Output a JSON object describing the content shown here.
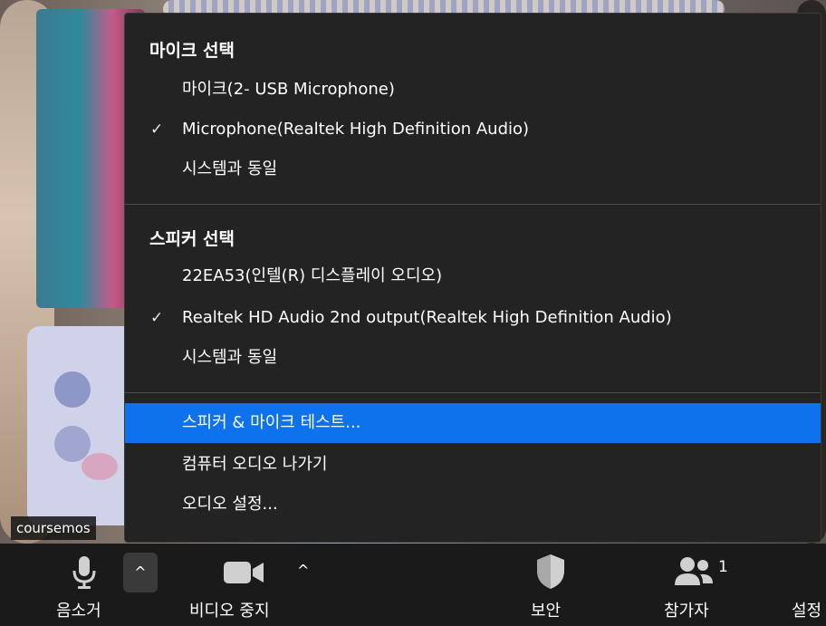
{
  "video": {
    "participant_name": "coursemos"
  },
  "menu": {
    "mic_section": {
      "title": "마이크 선택",
      "items": [
        {
          "label": "마이크(2- USB Microphone)",
          "checked": false
        },
        {
          "label": "Microphone(Realtek High Definition Audio)",
          "checked": true
        },
        {
          "label": "시스템과 동일",
          "checked": false
        }
      ]
    },
    "speaker_section": {
      "title": "스피커 선택",
      "items": [
        {
          "label": "22EA53(인텔(R) 디스플레이 오디오)",
          "checked": false
        },
        {
          "label": "Realtek HD Audio 2nd output(Realtek High Definition Audio)",
          "checked": true
        },
        {
          "label": "시스템과 동일",
          "checked": false
        }
      ]
    },
    "actions": [
      {
        "label": "스피커 & 마이크 테스트...",
        "highlighted": true
      },
      {
        "label": "컴퓨터 오디오 나가기",
        "highlighted": false
      },
      {
        "label": "오디오 설정...",
        "highlighted": false
      }
    ],
    "check_glyph": "✓",
    "highlight_color": "#0e72ed"
  },
  "toolbar": {
    "mute_label": "음소거",
    "video_label": "비디오 중지",
    "security_label": "보안",
    "participants_label": "참가자",
    "participants_count": "1",
    "settings_label": "설정",
    "caret_glyph": "^"
  }
}
